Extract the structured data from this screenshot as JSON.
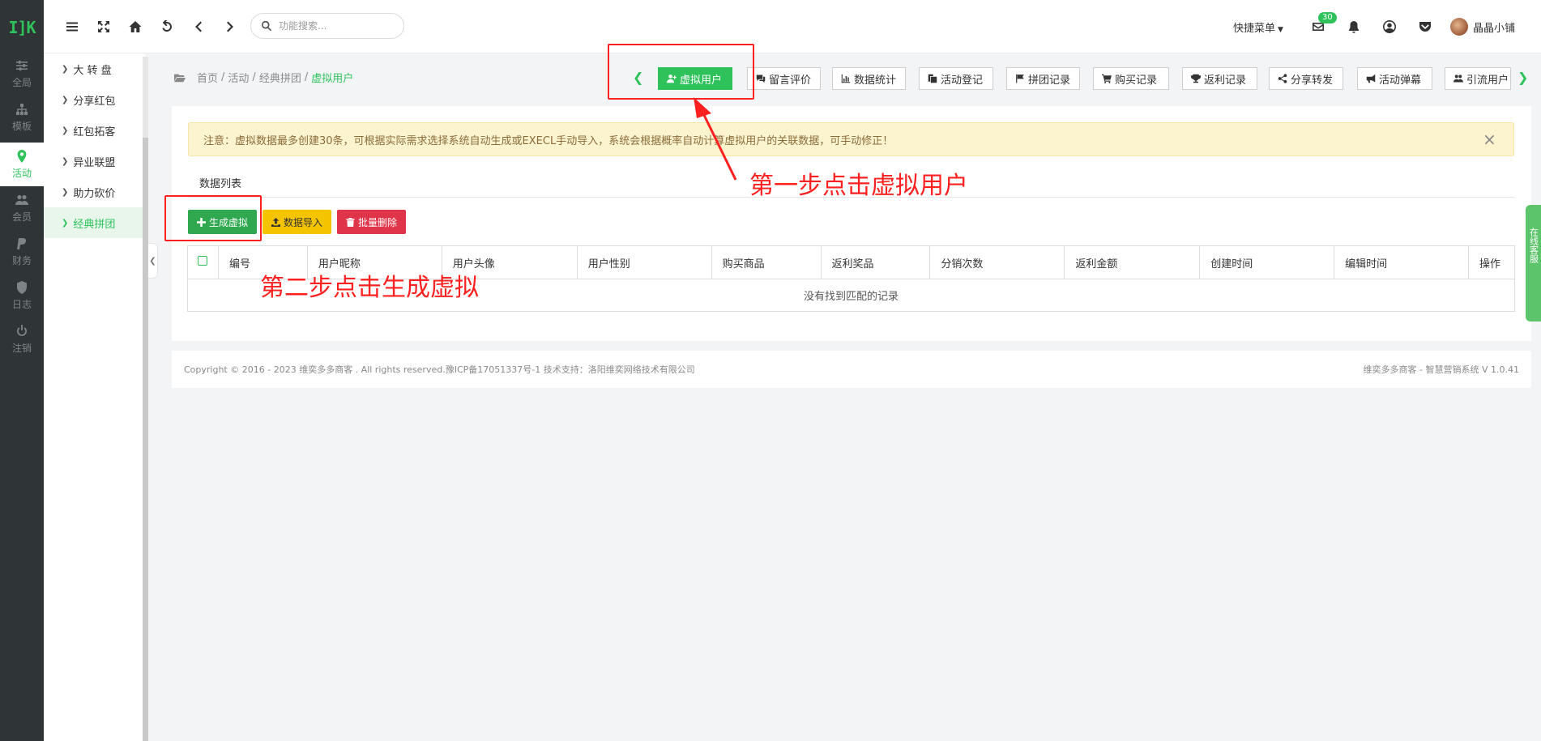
{
  "rail": {
    "logo": "I]K",
    "items": [
      {
        "label": "全局",
        "icon": "sliders-icon"
      },
      {
        "label": "模板",
        "icon": "sitemap-icon"
      },
      {
        "label": "活动",
        "icon": "map-pin-icon",
        "active": true
      },
      {
        "label": "会员",
        "icon": "users-icon"
      },
      {
        "label": "财务",
        "icon": "paypal-icon"
      },
      {
        "label": "日志",
        "icon": "shield-icon"
      },
      {
        "label": "注销",
        "icon": "power-icon"
      }
    ]
  },
  "submenu": {
    "items": [
      {
        "label": "大 转 盘"
      },
      {
        "label": "分享红包"
      },
      {
        "label": "红包拓客"
      },
      {
        "label": "异业联盟"
      },
      {
        "label": "助力砍价"
      },
      {
        "label": "经典拼团",
        "active": true
      }
    ]
  },
  "topbar": {
    "search_placeholder": "功能搜索...",
    "quick_menu": "快捷菜单",
    "mail_badge": "30",
    "username": "晶晶小铺"
  },
  "breadcrumb": {
    "items": [
      "首页",
      "活动",
      "经典拼团"
    ],
    "current": "虚拟用户"
  },
  "tabs": [
    {
      "label": "虚拟用户",
      "icon": "user-plus-icon",
      "active": true
    },
    {
      "label": "留言评价",
      "icon": "comments-icon"
    },
    {
      "label": "数据统计",
      "icon": "bar-chart-icon"
    },
    {
      "label": "活动登记",
      "icon": "copy-icon"
    },
    {
      "label": "拼团记录",
      "icon": "flag-icon"
    },
    {
      "label": "购买记录",
      "icon": "cart-icon"
    },
    {
      "label": "返利记录",
      "icon": "trophy-icon"
    },
    {
      "label": "分享转发",
      "icon": "share-icon"
    },
    {
      "label": "活动弹幕",
      "icon": "bullhorn-icon"
    },
    {
      "label": "引流用户",
      "icon": "users-icon"
    }
  ],
  "notice": {
    "text": "注意：虚拟数据最多创建30条，可根据实际需求选择系统自动生成或EXECL手动导入，系统会根据概率自动计算虚拟用户的关联数据，可手动修正！",
    "close": "×"
  },
  "list_tab": "数据列表",
  "actions": {
    "generate": "生成虚拟",
    "import": "数据导入",
    "batch_delete": "批量删除"
  },
  "table": {
    "columns": [
      "编号",
      "用户昵称",
      "用户头像",
      "用户性别",
      "购买商品",
      "返利奖品",
      "分销次数",
      "返利金额",
      "创建时间",
      "编辑时间",
      "操作"
    ],
    "empty": "没有找到匹配的记录"
  },
  "footer": {
    "left": "Copyright © 2016 - 2023 维奕多多商客 . All rights reserved.豫ICP备17051337号-1 技术支持：洛阳维奕网络技术有限公司",
    "right": "维奕多多商客 - 智慧营销系统 V 1.0.41"
  },
  "service_tab": "在线客服",
  "annotations": {
    "step1": "第一步点击虚拟用户",
    "step2": "第二步点击生成虚拟",
    "color": "#ff2020"
  },
  "colors": {
    "accent": "#2fc25b",
    "rail": "#2f3437",
    "notice_bg": "#fcf3cf",
    "danger": "#e0344a",
    "warning": "#f5c400"
  }
}
